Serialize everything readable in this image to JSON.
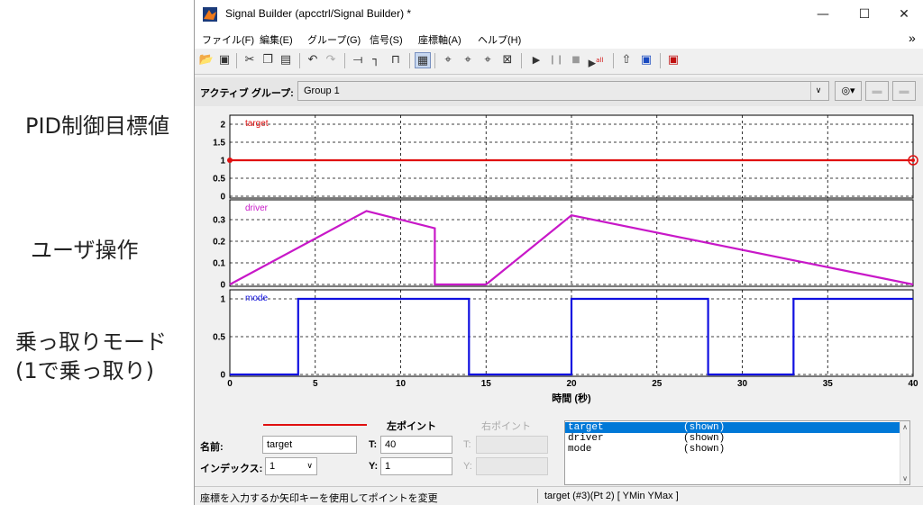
{
  "annotations": [
    {
      "text": "PID制御目標値"
    },
    {
      "text": "ユーザ操作"
    },
    {
      "text": "乗っ取りモード"
    },
    {
      "text": "(1で乗っ取り)"
    }
  ],
  "window": {
    "title": "Signal Builder (apcctrl/Signal Builder) *",
    "app_icon": "matlab-icon",
    "minimize": "—",
    "maximize": "☐",
    "close": "✕",
    "menu_overflow": "»"
  },
  "menu": [
    "ファイル(F)",
    "編集(E)",
    "グループ(G)",
    "信号(S)",
    "座標軸(A)",
    "ヘルプ(H)"
  ],
  "toolbar": {
    "icons": [
      "open-icon",
      "save-icon",
      "cut-icon",
      "copy-icon",
      "paste-icon",
      "undo-icon",
      "redo-icon",
      "constant-signal-icon",
      "step-icon",
      "pulse-icon",
      "grid-icon",
      "zoom-x-icon",
      "zoom-y-icon",
      "zoom-xy-icon",
      "fit-icon",
      "play-icon",
      "pause-icon",
      "stop-icon",
      "run-all-icon",
      "export-icon",
      "load-icon",
      "help-icon"
    ]
  },
  "group": {
    "label": "アクティブ グループ:",
    "value": "Group 1"
  },
  "chart_data": {
    "type": "line",
    "xlabel": "時間 (秒)",
    "xlim": [
      0,
      40
    ],
    "x_ticks": [
      "0",
      "5",
      "10",
      "15",
      "20",
      "25",
      "30",
      "35",
      "40"
    ],
    "grid": true,
    "axes": [
      {
        "name": "target",
        "color": "#e01010",
        "ylim": [
          0,
          2
        ],
        "yticks": [
          "2",
          "1.5",
          "1",
          "0.5",
          "0"
        ],
        "series": {
          "name": "target",
          "x": [
            0,
            40
          ],
          "y": [
            1,
            1
          ]
        }
      },
      {
        "name": "driver",
        "color": "#c818c8",
        "ylim": [
          0,
          0.35
        ],
        "yticks": [
          "0.3",
          "0.2",
          "0.1",
          "0"
        ],
        "series": {
          "name": "driver",
          "x": [
            0,
            8,
            12,
            12,
            15,
            20,
            40
          ],
          "y": [
            0,
            0.34,
            0.26,
            0,
            0,
            0.32,
            0
          ]
        }
      },
      {
        "name": "mode",
        "color": "#1010e0",
        "ylim": [
          0,
          1
        ],
        "yticks": [
          "1",
          "0.5",
          "0"
        ],
        "series": {
          "name": "mode",
          "x": [
            0,
            4,
            4,
            14,
            14,
            20,
            20,
            28,
            28,
            33,
            33,
            40
          ],
          "y": [
            0,
            0,
            1,
            1,
            0,
            0,
            1,
            1,
            0,
            0,
            1,
            1
          ]
        }
      }
    ]
  },
  "bottom": {
    "left_point": "左ポイント",
    "right_point": "右ポイント",
    "name_label": "名前:",
    "name_value": "target",
    "index_label": "インデックス:",
    "index_value": "1",
    "t_label": "T:",
    "t_value": "40",
    "y_label": "Y:",
    "y_value": "1",
    "rt_label": "T:",
    "ry_label": "Y:",
    "signals": [
      {
        "name": "target",
        "state": "(shown)"
      },
      {
        "name": "driver",
        "state": "(shown)"
      },
      {
        "name": "mode",
        "state": "(shown)"
      }
    ]
  },
  "status": {
    "left": "座標を入力するか矢印キーを使用してポイントを変更",
    "right": "target (#3)(Pt 2)  [ YMin YMax ]"
  }
}
